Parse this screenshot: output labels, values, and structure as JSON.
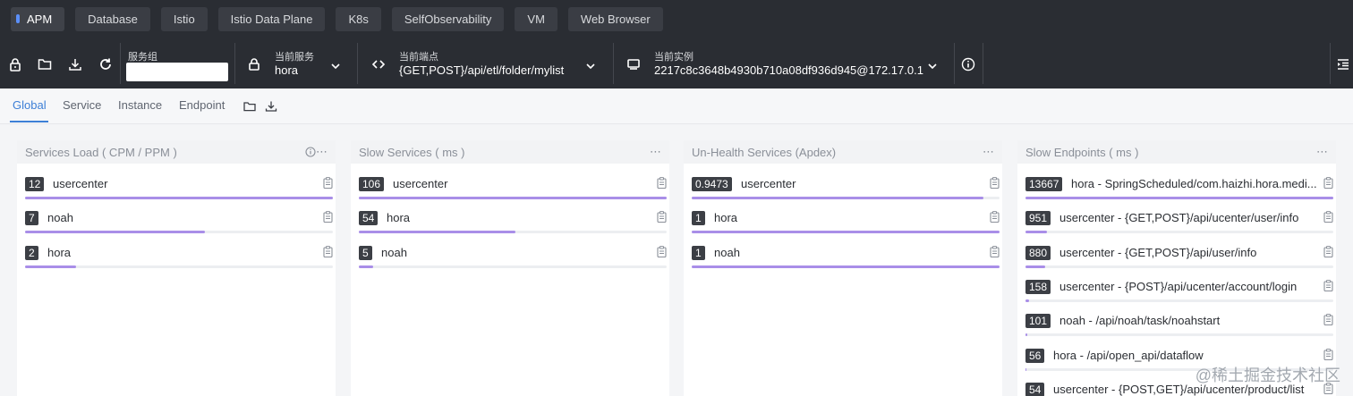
{
  "nav": {
    "items": [
      "APM",
      "Database",
      "Istio",
      "Istio Data Plane",
      "K8s",
      "SelfObservability",
      "VM",
      "Web Browser"
    ],
    "active": "APM",
    "accent": "#5b8ff9"
  },
  "toolbar": {
    "service_group_label": "服务组",
    "service_group_value": "",
    "current_service_label": "当前服务",
    "current_service_value": "hora",
    "current_endpoint_label": "当前端点",
    "current_endpoint_value": "{GET,POST}/api/etl/folder/mylist",
    "current_instance_label": "当前实例",
    "current_instance_value": "2217c8c3648b4930b710a08df936d945@172.17.0.1"
  },
  "tabs": {
    "items": [
      "Global",
      "Service",
      "Instance",
      "Endpoint"
    ],
    "active": "Global",
    "active_color": "#3d7fd6"
  },
  "panels": [
    {
      "title": "Services Load ( CPM / PPM )",
      "rows": [
        {
          "value": "12",
          "name": "usercenter",
          "level": 1.0
        },
        {
          "value": "7",
          "name": "noah",
          "level": 0.583
        },
        {
          "value": "2",
          "name": "hora",
          "level": 0.167
        }
      ]
    },
    {
      "title": "Slow Services ( ms )",
      "rows": [
        {
          "value": "106",
          "name": "usercenter",
          "level": 1.0
        },
        {
          "value": "54",
          "name": "hora",
          "level": 0.509
        },
        {
          "value": "5",
          "name": "noah",
          "level": 0.047
        }
      ]
    },
    {
      "title": "Un-Health Services (Apdex)",
      "rows": [
        {
          "value": "0.9473",
          "name": "usercenter",
          "level": 0.9473
        },
        {
          "value": "1",
          "name": "hora",
          "level": 1.0
        },
        {
          "value": "1",
          "name": "noah",
          "level": 1.0
        }
      ]
    },
    {
      "title": "Slow Endpoints ( ms )",
      "rows": [
        {
          "value": "13667",
          "name": "hora - SpringScheduled/com.haizhi.hora.medi...",
          "level": 1.0
        },
        {
          "value": "951",
          "name": "usercenter - {GET,POST}/api/ucenter/user/info",
          "level": 0.07
        },
        {
          "value": "880",
          "name": "usercenter - {GET,POST}/api/user/info",
          "level": 0.064
        },
        {
          "value": "158",
          "name": "usercenter - {POST}/api/ucenter/account/login",
          "level": 0.012
        },
        {
          "value": "101",
          "name": "noah - /api/noah/task/noahstart",
          "level": 0.007
        },
        {
          "value": "56",
          "name": "hora - /api/open_api/dataflow",
          "level": 0.004
        },
        {
          "value": "54",
          "name": "usercenter - {POST,GET}/api/ucenter/product/list",
          "level": 0.004
        }
      ]
    }
  ],
  "bar_color": "#a98ee8",
  "watermark": "@稀土掘金技术社区"
}
